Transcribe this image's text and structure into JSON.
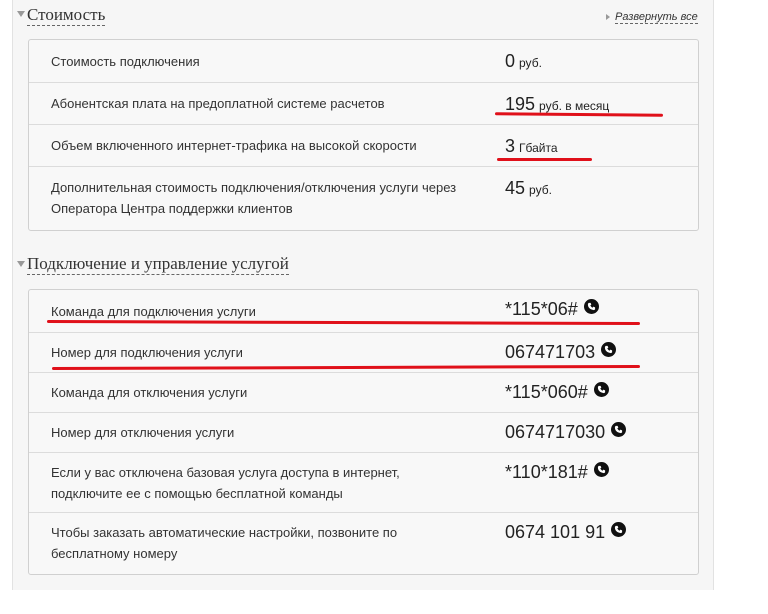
{
  "sections": {
    "cost": {
      "title": "Стоимость",
      "expand_label": "Развернуть все",
      "rows": [
        {
          "label": "Стоимость подключения",
          "value": "0",
          "unit": "руб."
        },
        {
          "label": "Абонентская плата на предоплатной системе расчетов",
          "value": "195",
          "unit": "руб. в месяц"
        },
        {
          "label": "Объем включенного интернет-трафика на высокой скорости",
          "value": "3",
          "unit": "Гбайта"
        },
        {
          "label": "Дополнительная стоимость подключения/отключения услуги через Оператора Центра поддержки клиентов",
          "value": "45",
          "unit": "руб."
        }
      ]
    },
    "management": {
      "title": "Подключение и управление услугой",
      "rows": [
        {
          "label": "Команда для подключения услуги",
          "value": "*115*06#"
        },
        {
          "label": "Номер для подключения услуги",
          "value": "067471703"
        },
        {
          "label": "Команда для отключения услуги",
          "value": "*115*060#"
        },
        {
          "label": "Номер для отключения услуги",
          "value": "0674717030"
        },
        {
          "label": "Если у вас отключена базовая услуга доступа в интернет, подключите ее с помощью бесплатной команды",
          "value": "*110*181#"
        },
        {
          "label": "Чтобы заказать автоматические настройки, позвоните по бесплатному номеру",
          "value": "0674 101 91"
        }
      ]
    }
  },
  "annotation_color": "#e0101a"
}
